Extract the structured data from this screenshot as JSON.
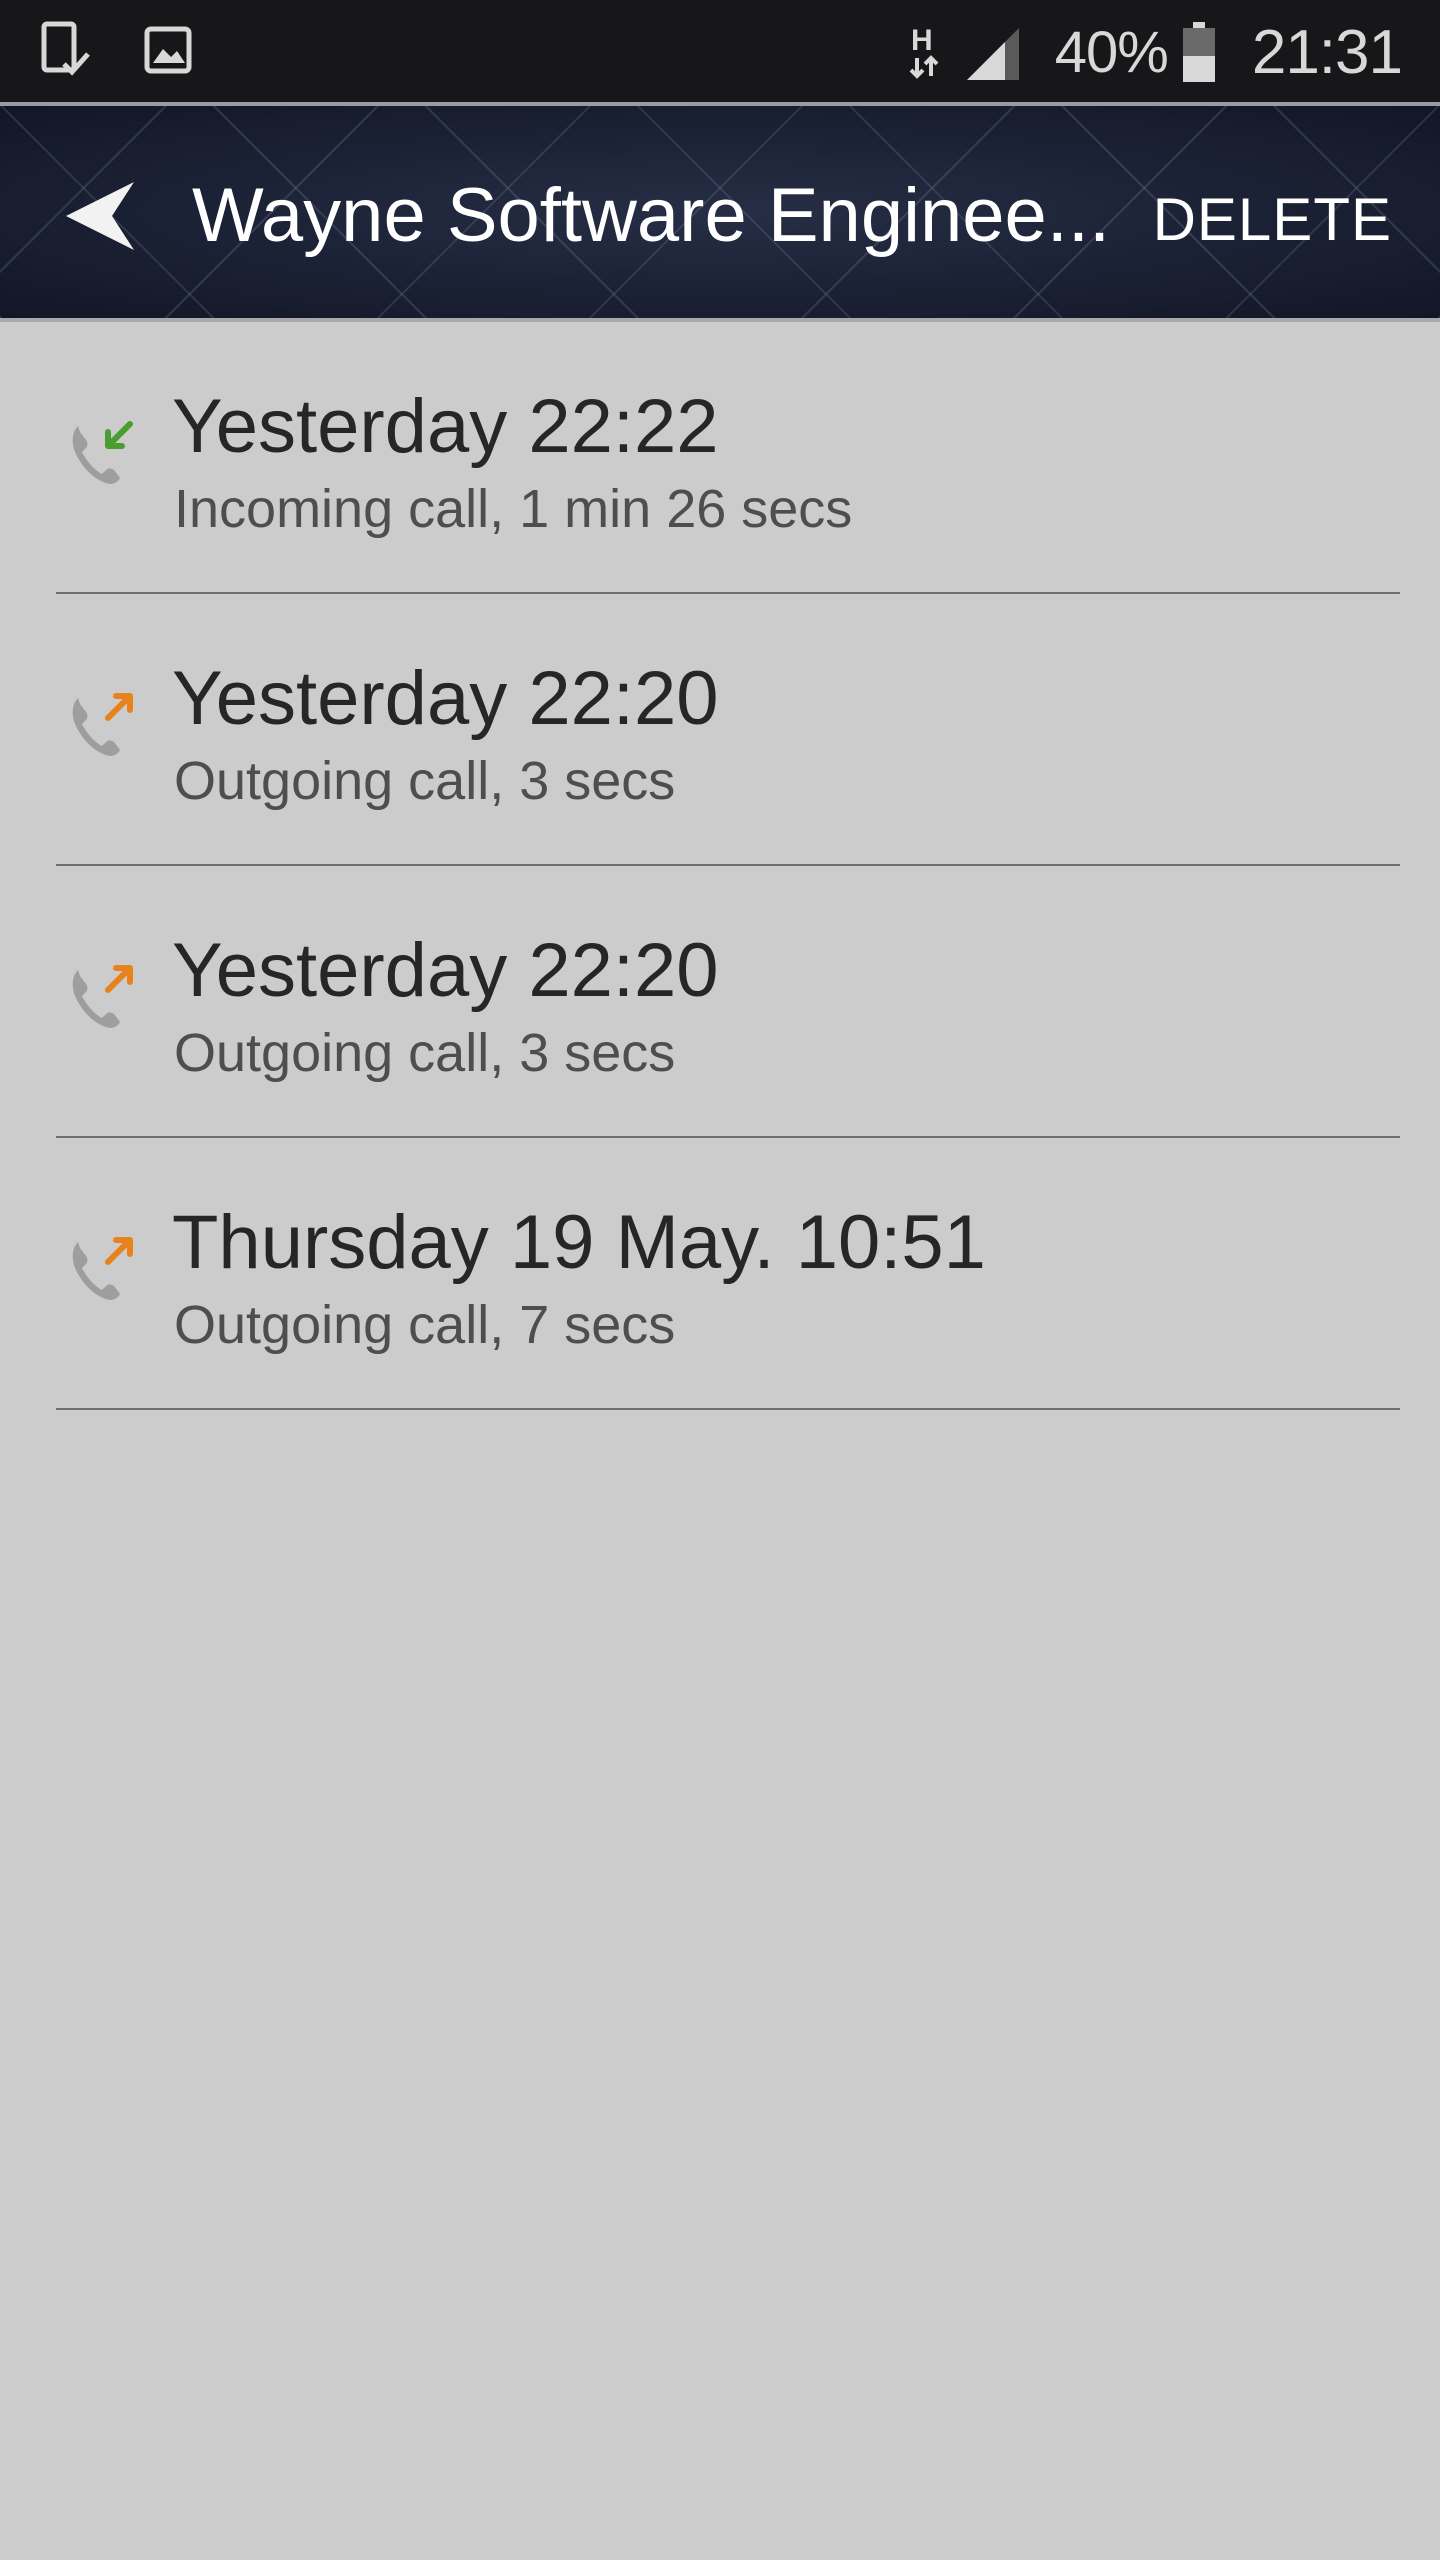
{
  "status_bar": {
    "icons_left": [
      "tablet-check-icon",
      "image-icon"
    ],
    "network_type": "H",
    "battery_percent": "40%",
    "time": "21:31"
  },
  "header": {
    "title": "Wayne Software Enginee...",
    "delete_label": "DELETE"
  },
  "calls": [
    {
      "time": "Yesterday 22:22",
      "description": "Incoming call, 1 min 26 secs",
      "direction": "incoming",
      "arrow_color": "#4a9d2f"
    },
    {
      "time": "Yesterday 22:20",
      "description": "Outgoing call, 3 secs",
      "direction": "outgoing",
      "arrow_color": "#e8821c"
    },
    {
      "time": "Yesterday 22:20",
      "description": "Outgoing call, 3 secs",
      "direction": "outgoing",
      "arrow_color": "#e8821c"
    },
    {
      "time": "Thursday 19 May. 10:51",
      "description": "Outgoing call, 7 secs",
      "direction": "outgoing",
      "arrow_color": "#e8821c"
    }
  ],
  "colors": {
    "background": "#cccccc",
    "status_bar": "#17171a",
    "app_bar": "#151a2c",
    "divider": "#6f6f6f",
    "phone_icon": "#9e9e9e"
  }
}
